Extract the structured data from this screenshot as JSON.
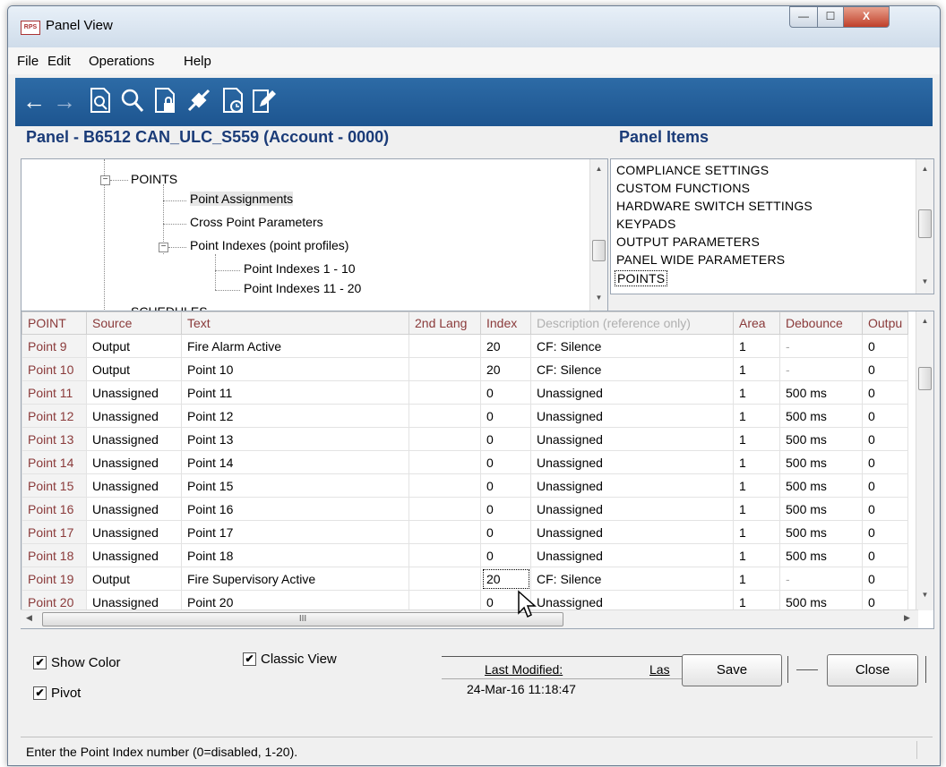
{
  "window": {
    "app_icon": "RPS",
    "title": "Panel View",
    "buttons": {
      "minimize": "—",
      "maximize": "☐",
      "close": "X"
    }
  },
  "menu": {
    "items": [
      "File",
      "Edit",
      "Operations",
      "Help"
    ]
  },
  "toolbar": {
    "icons": [
      "back-arrow-icon",
      "forward-arrow-icon",
      "print-preview-icon",
      "search-icon",
      "lock-document-icon",
      "connect-icon",
      "history-document-icon",
      "edit-document-icon"
    ]
  },
  "panel": {
    "title": "Panel - B6512 CAN_ULC_S559 (Account - 0000)"
  },
  "tree": {
    "nodes": [
      {
        "label": "POINTS",
        "expander": "−"
      },
      {
        "label": "Point Assignments"
      },
      {
        "label": "Cross Point Parameters"
      },
      {
        "label": "Point Indexes (point profiles)",
        "expander": "−"
      },
      {
        "label": "Point Indexes 1 - 10"
      },
      {
        "label": "Point Indexes 11 - 20"
      },
      {
        "label": "SCHEDULES"
      }
    ]
  },
  "panel_items": {
    "title": "Panel Items",
    "items": [
      "COMPLIANCE SETTINGS",
      "CUSTOM FUNCTIONS",
      "HARDWARE SWITCH SETTINGS",
      "KEYPADS",
      "OUTPUT PARAMETERS",
      "PANEL WIDE PARAMETERS",
      "POINTS"
    ]
  },
  "grid": {
    "columns": [
      "POINT",
      "Source",
      "Text",
      "2nd Lang",
      "Index",
      "Description (reference only)",
      "Area",
      "Debounce",
      "Outpu"
    ],
    "rows": [
      [
        "Point 9",
        "Output",
        "Fire Alarm Active",
        "",
        "20",
        "CF: Silence",
        "1",
        "-",
        "0"
      ],
      [
        "Point 10",
        "Output",
        "Point 10",
        "",
        "20",
        "CF: Silence",
        "1",
        "-",
        "0"
      ],
      [
        "Point 11",
        "Unassigned",
        "Point 11",
        "",
        "0",
        "Unassigned",
        "1",
        "500 ms",
        "0"
      ],
      [
        "Point 12",
        "Unassigned",
        "Point 12",
        "",
        "0",
        "Unassigned",
        "1",
        "500 ms",
        "0"
      ],
      [
        "Point 13",
        "Unassigned",
        "Point 13",
        "",
        "0",
        "Unassigned",
        "1",
        "500 ms",
        "0"
      ],
      [
        "Point 14",
        "Unassigned",
        "Point 14",
        "",
        "0",
        "Unassigned",
        "1",
        "500 ms",
        "0"
      ],
      [
        "Point 15",
        "Unassigned",
        "Point 15",
        "",
        "0",
        "Unassigned",
        "1",
        "500 ms",
        "0"
      ],
      [
        "Point 16",
        "Unassigned",
        "Point 16",
        "",
        "0",
        "Unassigned",
        "1",
        "500 ms",
        "0"
      ],
      [
        "Point 17",
        "Unassigned",
        "Point 17",
        "",
        "0",
        "Unassigned",
        "1",
        "500 ms",
        "0"
      ],
      [
        "Point 18",
        "Unassigned",
        "Point 18",
        "",
        "0",
        "Unassigned",
        "1",
        "500 ms",
        "0"
      ],
      [
        "Point 19",
        "Output",
        "Fire Supervisory Active",
        "",
        "20",
        "CF: Silence",
        "1",
        "-",
        "0"
      ],
      [
        "Point 20",
        "Unassigned",
        "Point 20",
        "",
        "0",
        "Unassigned",
        "1",
        "500 ms",
        "0"
      ]
    ],
    "hscroll_marker": "III"
  },
  "options": {
    "show_color": {
      "label": "Show Color",
      "checked": true
    },
    "pivot": {
      "label": "Pivot",
      "checked": true
    },
    "classic_view": {
      "label": "Classic View",
      "checked": true
    }
  },
  "modified": {
    "label": "Last Modified:",
    "value": "24-Mar-16 11:18:47",
    "second_label": "Las"
  },
  "buttons": {
    "save": "Save",
    "close": "Close"
  },
  "status": {
    "text": "Enter the Point Index number (0=disabled, 1-20)."
  }
}
